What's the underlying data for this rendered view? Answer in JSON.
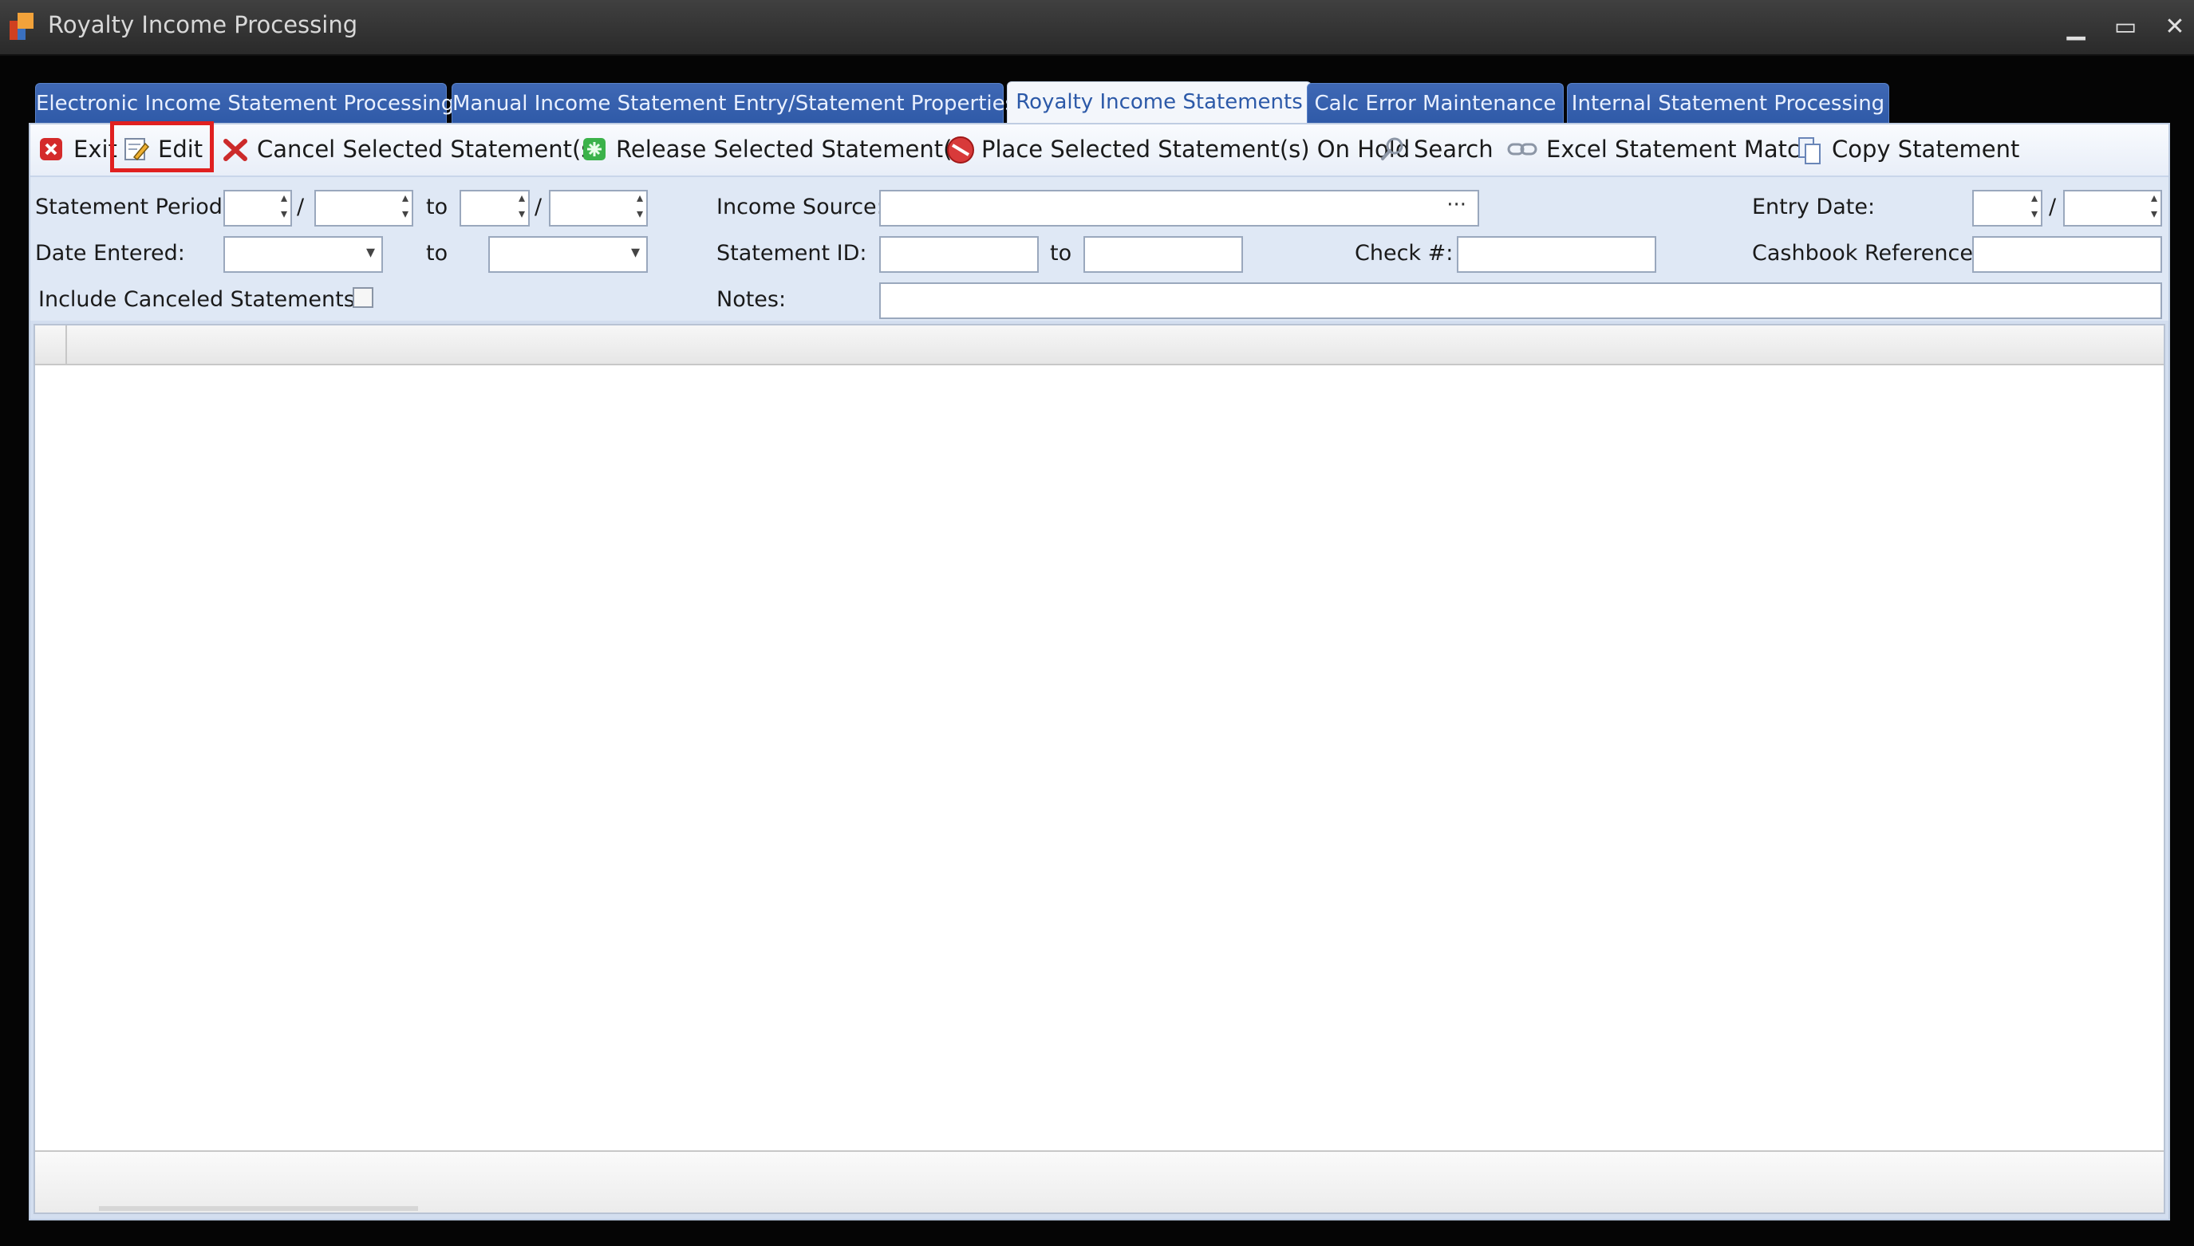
{
  "window": {
    "title": "Royalty Income Processing",
    "minimize_glyph": "▁",
    "maximize_glyph": "▭",
    "close_glyph": "✕"
  },
  "tabs": [
    {
      "label": "Electronic Income Statement Processing",
      "active": false
    },
    {
      "label": "Manual Income Statement Entry/Statement Properties",
      "active": false
    },
    {
      "label": "Royalty Income Statements",
      "active": true
    },
    {
      "label": "Calc Error Maintenance",
      "active": false
    },
    {
      "label": "Internal Statement Processing",
      "active": false
    }
  ],
  "toolbar": {
    "exit": "Exit",
    "edit": "Edit",
    "cancel": "Cancel Selected Statement(s)",
    "release": "Release Selected Statement(s)",
    "hold": "Place Selected Statement(s) On Hold",
    "search": "Search",
    "excel_match": "Excel Statement Match",
    "copy": "Copy Statement"
  },
  "filters": {
    "statement_period_label": "Statement Period:",
    "slash": "/",
    "to": "to",
    "date_entered_label": "Date Entered:",
    "include_canceled_label": "Include Canceled Statements:",
    "income_source_label": "Income Source:",
    "ellipsis": "···",
    "statement_id_label": "Statement ID:",
    "notes_label": "Notes:",
    "check_label": "Check #:",
    "entry_date_label": "Entry Date:",
    "cashbook_label": "Cashbook Reference:"
  },
  "colors": {
    "highlight": "#e02020",
    "tab_inactive": "#2f5aa8",
    "panel_bg": "#dfe8f5"
  }
}
